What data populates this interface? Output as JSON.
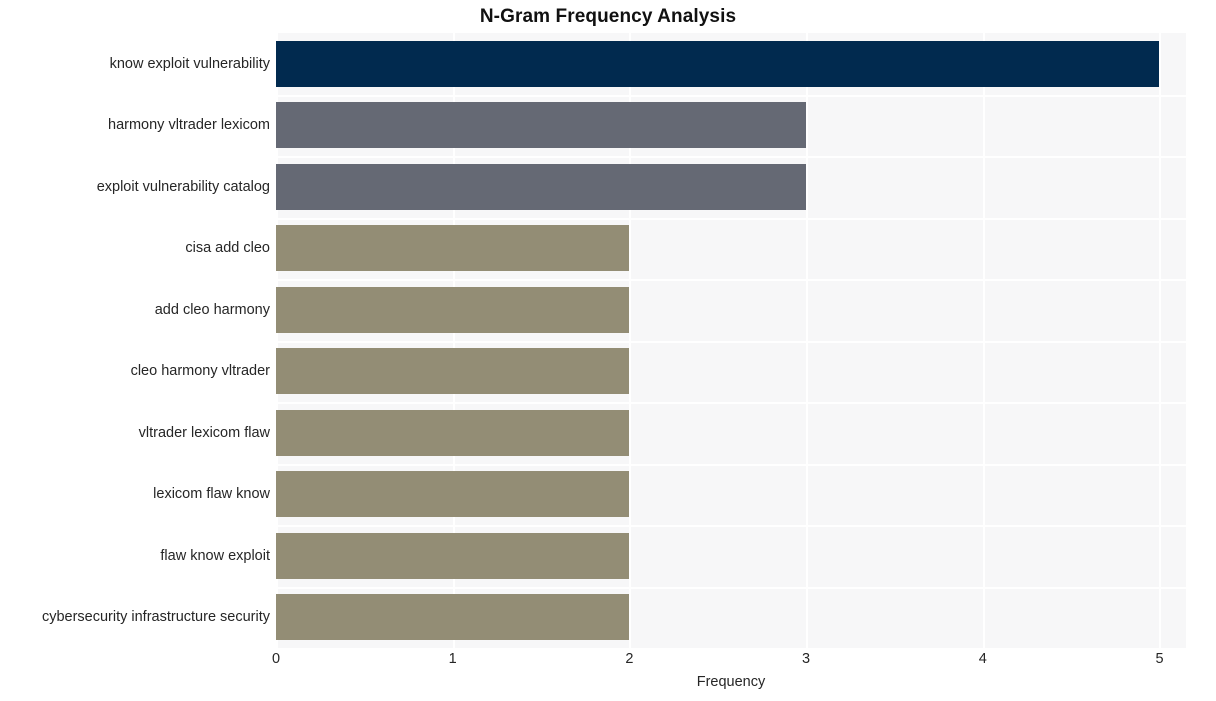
{
  "chart_data": {
    "type": "bar",
    "orientation": "horizontal",
    "title": "N-Gram Frequency Analysis",
    "xlabel": "Frequency",
    "ylabel": "",
    "xlim": [
      0,
      5.15
    ],
    "xticks": [
      0,
      1,
      2,
      3,
      4,
      5
    ],
    "xtick_labels": [
      "0",
      "1",
      "2",
      "3",
      "4",
      "5"
    ],
    "grid": true,
    "grid_color": "#ffffff",
    "plot_background": "#f7f7f8",
    "figure_background": "#ffffff",
    "legend": null,
    "categories": [
      "know exploit vulnerability",
      "harmony vltrader lexicom",
      "exploit vulnerability catalog",
      "cisa add cleo",
      "add cleo harmony",
      "cleo harmony vltrader",
      "vltrader lexicom flaw",
      "lexicom flaw know",
      "flaw know exploit",
      "cybersecurity infrastructure security"
    ],
    "values": [
      5,
      3,
      3,
      2,
      2,
      2,
      2,
      2,
      2,
      2
    ],
    "bar_colors": [
      "#012a4f",
      "#656974",
      "#656974",
      "#938d75",
      "#938d75",
      "#938d75",
      "#938d75",
      "#938d75",
      "#938d75",
      "#938d75"
    ]
  }
}
